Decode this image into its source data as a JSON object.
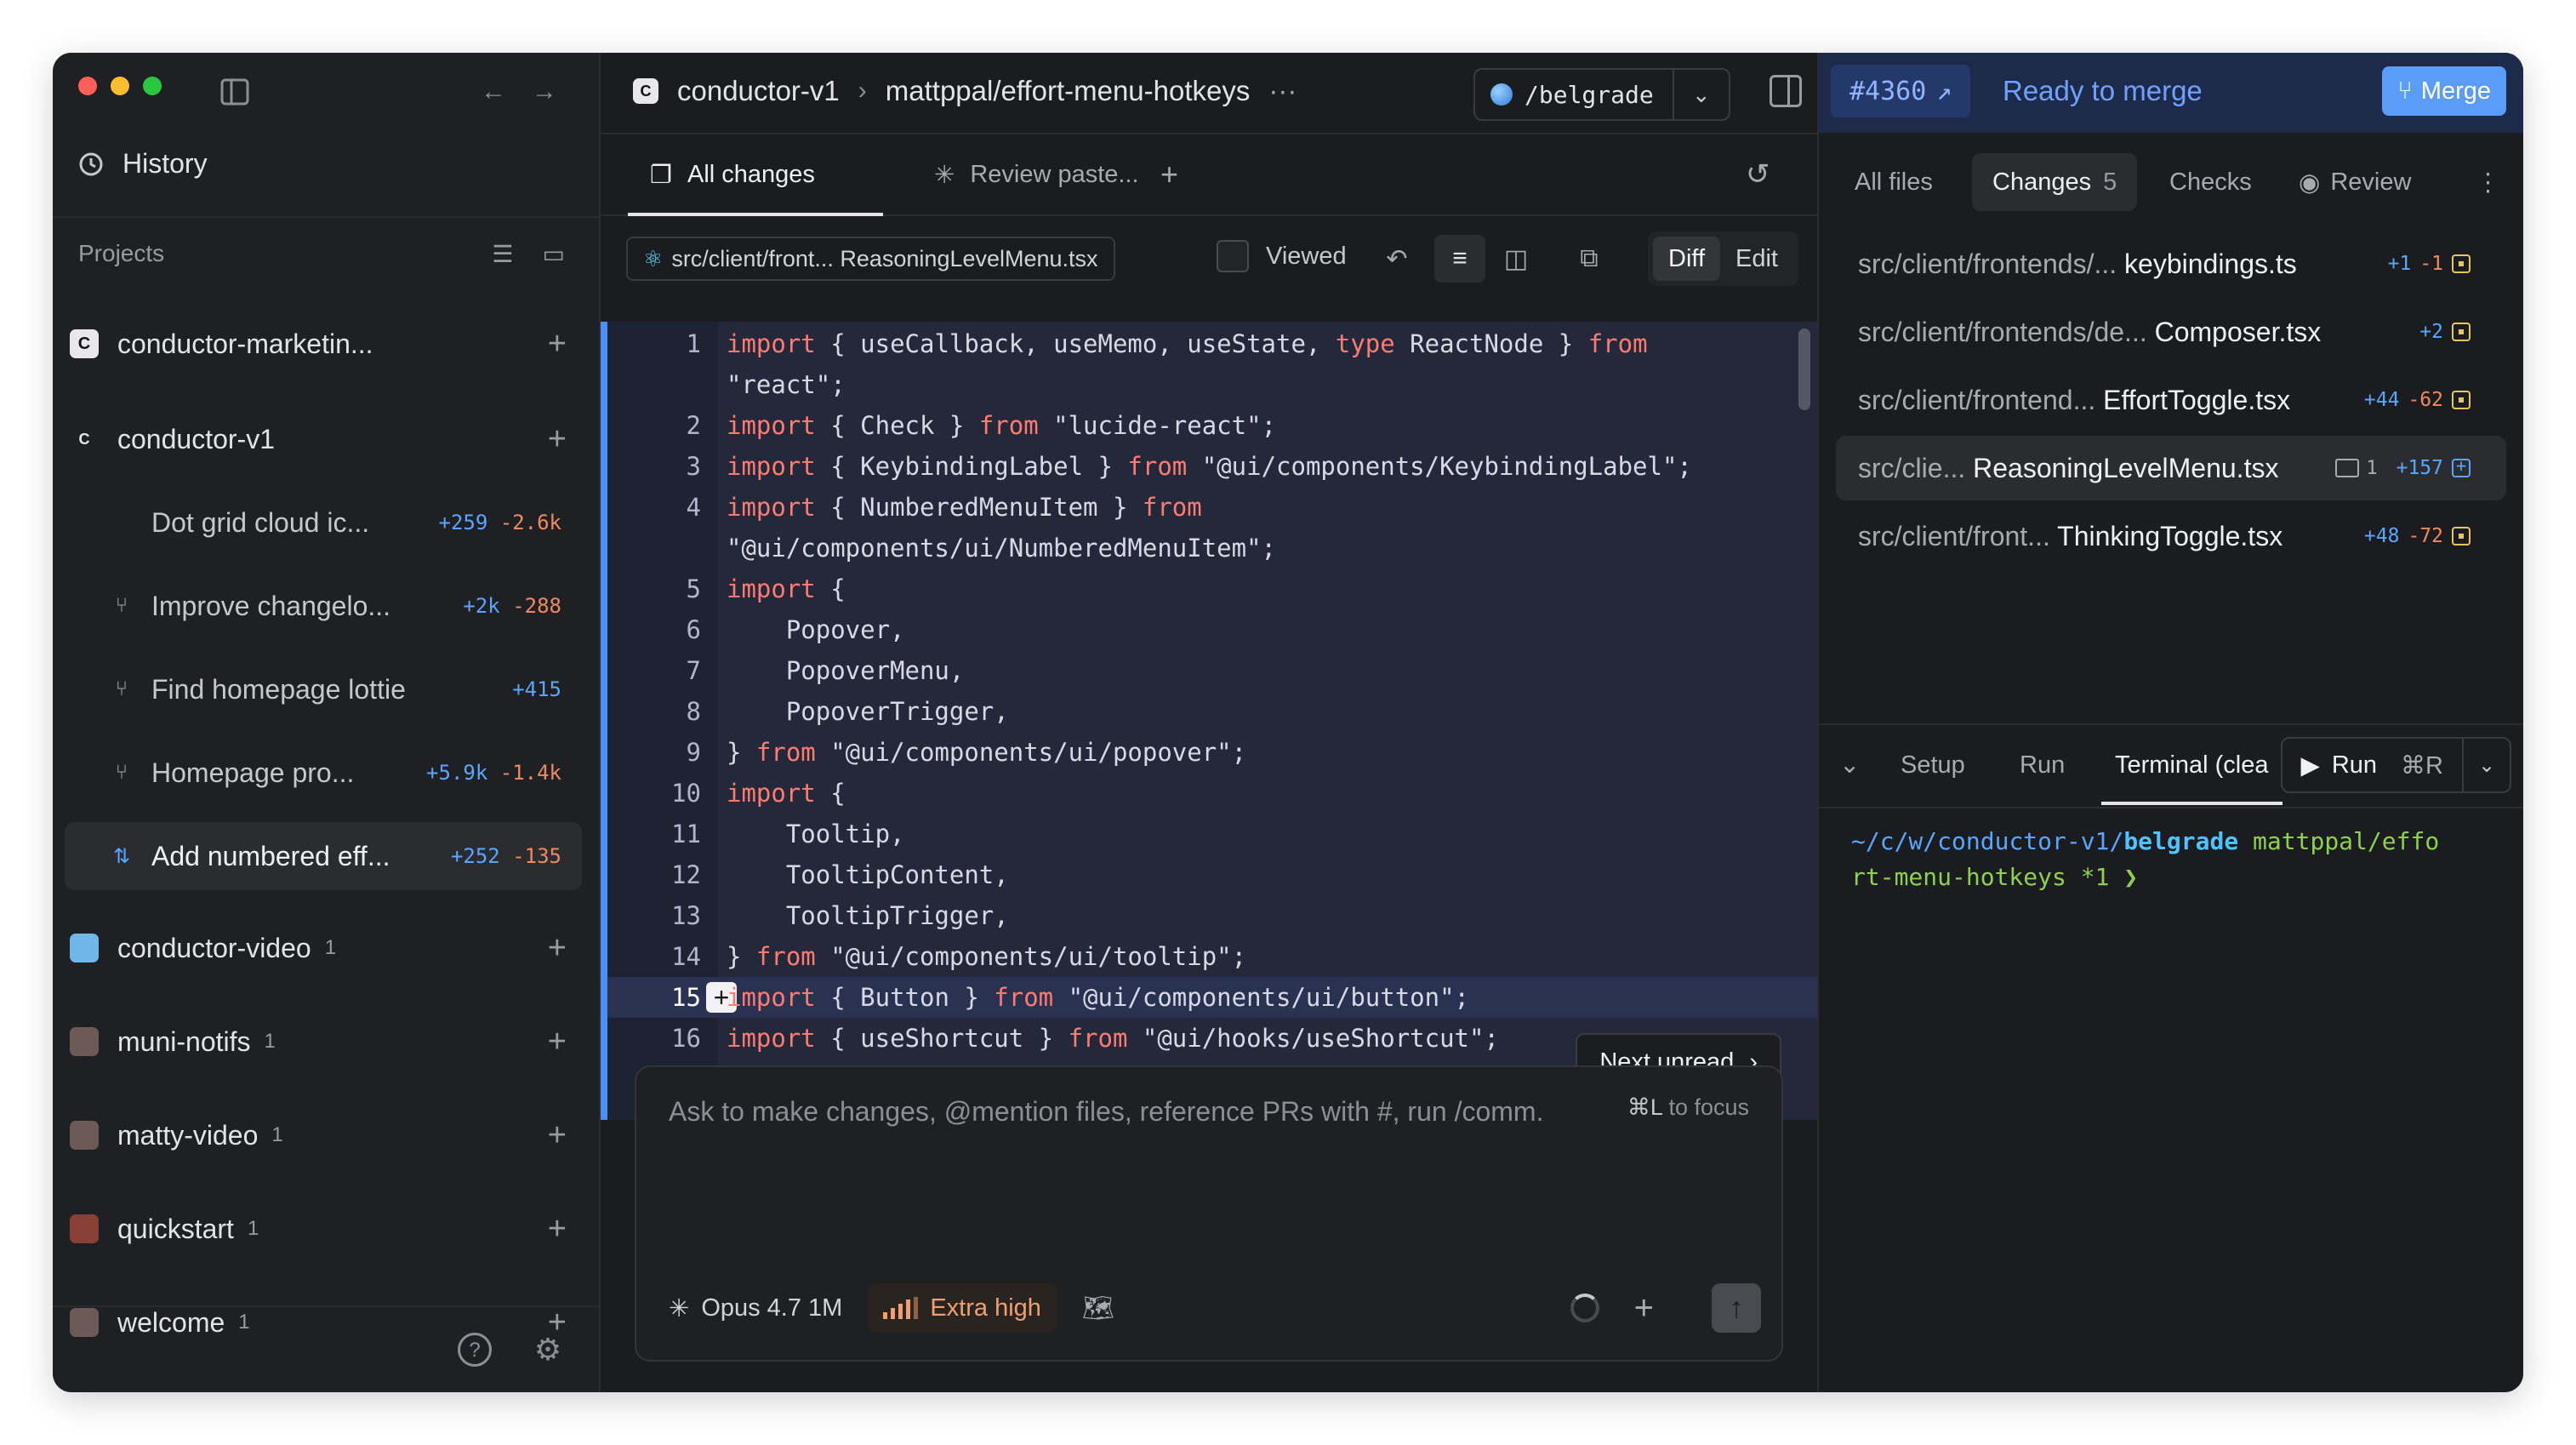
{
  "sidebar": {
    "history_label": "History",
    "projects_label": "Projects",
    "projects": [
      {
        "name": "conductor-marketin...",
        "count": "",
        "workspaces": []
      },
      {
        "name": "conductor-v1",
        "count": "",
        "workspaces": [
          {
            "name": "Dot grid cloud ic...",
            "add": "+259",
            "del": "-2.6k",
            "icon": "none"
          },
          {
            "name": "Improve changelo...",
            "add": "+2k",
            "del": "-288",
            "icon": "branch-icon"
          },
          {
            "name": "Find homepage lottie",
            "add": "+415",
            "del": "",
            "icon": "branch-icon"
          },
          {
            "name": "Homepage pro...",
            "add": "+5.9k",
            "del": "-1.4k",
            "icon": "branch-icon"
          },
          {
            "name": "Add numbered eff...",
            "add": "+252",
            "del": "-135",
            "icon": "pull-request-icon",
            "active": true
          }
        ]
      },
      {
        "name": "conductor-video",
        "count": "1"
      },
      {
        "name": "muni-notifs",
        "count": "1"
      },
      {
        "name": "matty-video",
        "count": "1"
      },
      {
        "name": "quickstart",
        "count": "1"
      },
      {
        "name": "welcome",
        "count": "1"
      }
    ]
  },
  "header": {
    "repo": "conductor-v1",
    "branch": "mattppal/effort-menu-hotkeys",
    "more": "···",
    "workspace": "/belgrade"
  },
  "tabs": [
    {
      "label": "All changes",
      "icon": "copy-icon",
      "active": true
    },
    {
      "label": "Review paste...",
      "icon": "sparkle-icon",
      "active": false
    }
  ],
  "toolbar": {
    "file_path": "src/client/front... ReasoningLevelMenu.tsx",
    "viewed_label": "Viewed",
    "diff_label": "Diff",
    "edit_label": "Edit"
  },
  "code_lines": [
    {
      "n": "1",
      "parts": [
        [
          "kw",
          "import"
        ],
        [
          "t",
          " { useCallback, useMemo, useState, "
        ],
        [
          "kw",
          "type"
        ],
        [
          "t",
          " ReactNode } "
        ],
        [
          "kw",
          "from"
        ]
      ]
    },
    {
      "n": "",
      "parts": [
        [
          "t",
          "\"react\";"
        ]
      ]
    },
    {
      "n": "2",
      "parts": [
        [
          "kw",
          "import"
        ],
        [
          "t",
          " { Check } "
        ],
        [
          "kw",
          "from"
        ],
        [
          "t",
          " \"lucide-react\";"
        ]
      ]
    },
    {
      "n": "3",
      "parts": [
        [
          "kw",
          "import"
        ],
        [
          "t",
          " { KeybindingLabel } "
        ],
        [
          "kw",
          "from"
        ],
        [
          "t",
          " \"@ui/components/KeybindingLabel\";"
        ]
      ]
    },
    {
      "n": "4",
      "parts": [
        [
          "kw",
          "import"
        ],
        [
          "t",
          " { NumberedMenuItem } "
        ],
        [
          "kw",
          "from"
        ]
      ]
    },
    {
      "n": "",
      "parts": [
        [
          "t",
          "\"@ui/components/ui/NumberedMenuItem\";"
        ]
      ]
    },
    {
      "n": "5",
      "parts": [
        [
          "kw",
          "import"
        ],
        [
          "t",
          " {"
        ]
      ]
    },
    {
      "n": "6",
      "parts": [
        [
          "t",
          "    Popover,"
        ]
      ]
    },
    {
      "n": "7",
      "parts": [
        [
          "t",
          "    PopoverMenu,"
        ]
      ]
    },
    {
      "n": "8",
      "parts": [
        [
          "t",
          "    PopoverTrigger,"
        ]
      ]
    },
    {
      "n": "9",
      "parts": [
        [
          "t",
          "} "
        ],
        [
          "kw",
          "from"
        ],
        [
          "t",
          " \"@ui/components/ui/popover\";"
        ]
      ]
    },
    {
      "n": "10",
      "parts": [
        [
          "kw",
          "import"
        ],
        [
          "t",
          " {"
        ]
      ]
    },
    {
      "n": "11",
      "parts": [
        [
          "t",
          "    Tooltip,"
        ]
      ]
    },
    {
      "n": "12",
      "parts": [
        [
          "t",
          "    TooltipContent,"
        ]
      ]
    },
    {
      "n": "13",
      "parts": [
        [
          "t",
          "    TooltipTrigger,"
        ]
      ]
    },
    {
      "n": "14",
      "parts": [
        [
          "t",
          "} "
        ],
        [
          "kw",
          "from"
        ],
        [
          "t",
          " \"@ui/components/ui/tooltip\";"
        ]
      ]
    },
    {
      "n": "15",
      "hl": true,
      "parts": [
        [
          "kw",
          "import"
        ],
        [
          "t",
          " { Button } "
        ],
        [
          "kw",
          "from"
        ],
        [
          "t",
          " \"@ui/components/ui/button\";"
        ]
      ]
    },
    {
      "n": "16",
      "parts": [
        [
          "kw",
          "import"
        ],
        [
          "t",
          " { useShortcut } "
        ],
        [
          "kw",
          "from"
        ],
        [
          "t",
          " \"@ui/hooks/useShortcut\";"
        ]
      ]
    }
  ],
  "next_unread_label": "Next unread",
  "composer": {
    "placeholder": "Ask to make changes, @mention files, reference PRs with #, run /comm.",
    "focus_key": "⌘L",
    "focus_label": "to focus",
    "model": "Opus 4.7 1M",
    "effort": "Extra high"
  },
  "pr": {
    "number": "#4360",
    "status": "Ready to merge",
    "merge_label": "Merge"
  },
  "right_tabs": {
    "all_files": "All files",
    "changes": "Changes",
    "changes_count": "5",
    "checks": "Checks",
    "review": "Review"
  },
  "files": [
    {
      "dir": "src/client/frontends/...",
      "name": "keybindings.ts",
      "add": "+1",
      "del": "-1",
      "status": "modified"
    },
    {
      "dir": "src/client/frontends/de...",
      "name": "Composer.tsx",
      "add": "+2",
      "del": "",
      "status": "modified"
    },
    {
      "dir": "src/client/frontend...",
      "name": "EffortToggle.tsx",
      "add": "+44",
      "del": "-62",
      "status": "modified"
    },
    {
      "dir": "src/clie...",
      "name": "ReasoningLevelMenu.tsx",
      "comments": "1",
      "add": "+157",
      "del": "",
      "status": "added",
      "active": true
    },
    {
      "dir": "src/client/front...",
      "name": "ThinkingToggle.tsx",
      "add": "+48",
      "del": "-72",
      "status": "modified"
    }
  ],
  "terminal": {
    "tabs": [
      "Setup",
      "Run",
      "Terminal (clea"
    ],
    "run_label": "Run",
    "run_key": "⌘R",
    "path_dim": "~/c/w/",
    "path_repo": "conductor-v1/",
    "path_ws": "belgrade",
    "branch_a": " mattppal/effo",
    "branch_b": "rt-menu-hotkeys *1 ❯"
  },
  "colors": {
    "accent": "#5aa6ff",
    "deletion": "#f08a5d",
    "keyword": "#ff7b72",
    "pr_bar": "#1e2a4a",
    "merge_button": "#5a9cf8"
  }
}
